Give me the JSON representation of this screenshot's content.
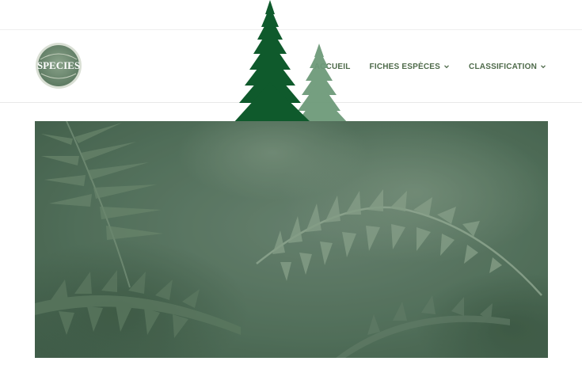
{
  "site": {
    "logo_text": "SPECIES"
  },
  "nav": {
    "items": [
      {
        "label": "ACCUEIL",
        "has_dropdown": false
      },
      {
        "label": "FICHES ESPÈCES",
        "has_dropdown": true
      },
      {
        "label": "CLASSIFICATION",
        "has_dropdown": true
      }
    ]
  },
  "colors": {
    "nav_text": "#4e6a4a",
    "tree_dark": "#0f5a2c",
    "tree_light": "#6e9a7a",
    "hero_overlay": "#4f6a57"
  },
  "hero": {
    "image": "fern-leaves-photo"
  }
}
